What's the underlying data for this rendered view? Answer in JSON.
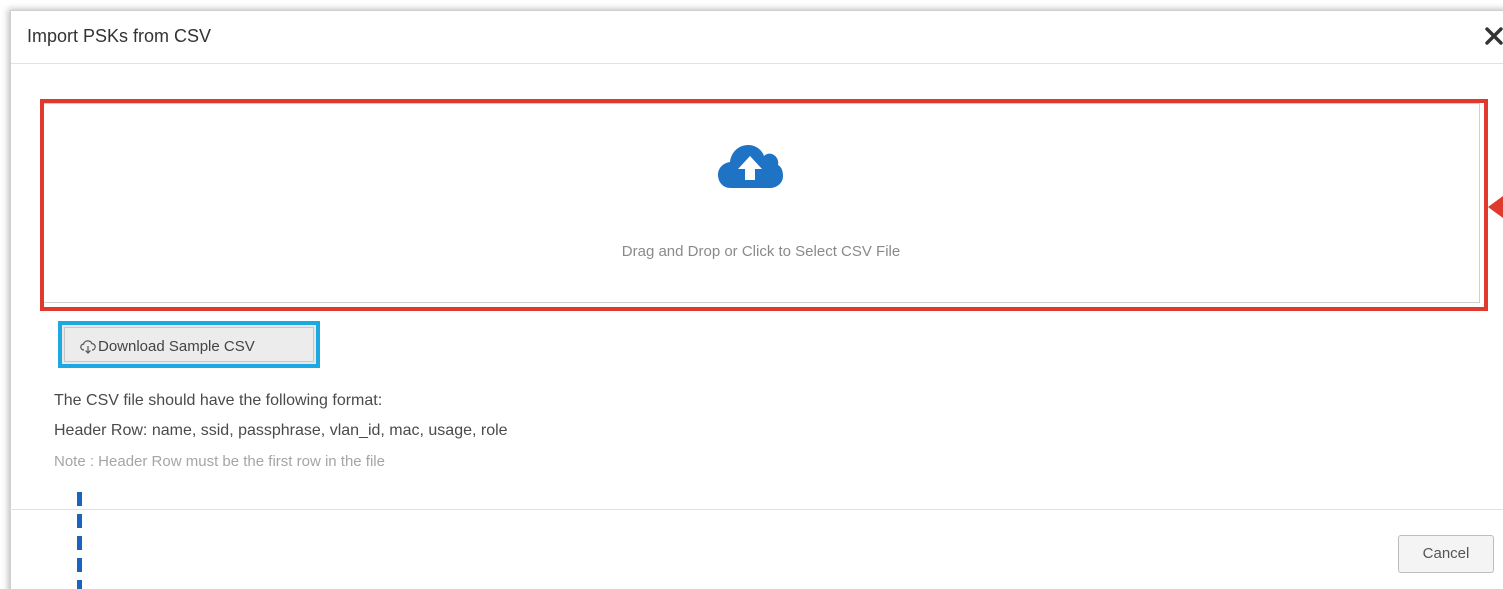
{
  "dialog": {
    "title": "Import PSKs from CSV",
    "close_icon": "close-icon"
  },
  "dropzone": {
    "icon": "cloud-upload-icon",
    "icon_color": "#1f73c4",
    "label": "Drag and Drop or Click to Select CSV File"
  },
  "download": {
    "icon": "cloud-download-icon",
    "label": "Download Sample CSV"
  },
  "info": {
    "format_intro": "The CSV file should have the following format:",
    "header_row": "Header Row: name, ssid, passphrase, vlan_id, mac, usage, role",
    "note": "Note : Header Row must be the first row in the file"
  },
  "footer": {
    "cancel_label": "Cancel"
  },
  "annotations": {
    "dropzone_highlight_color": "#e03a2f",
    "download_highlight_color": "#1ca8e0",
    "dashed_line_color": "#1a63c0"
  }
}
